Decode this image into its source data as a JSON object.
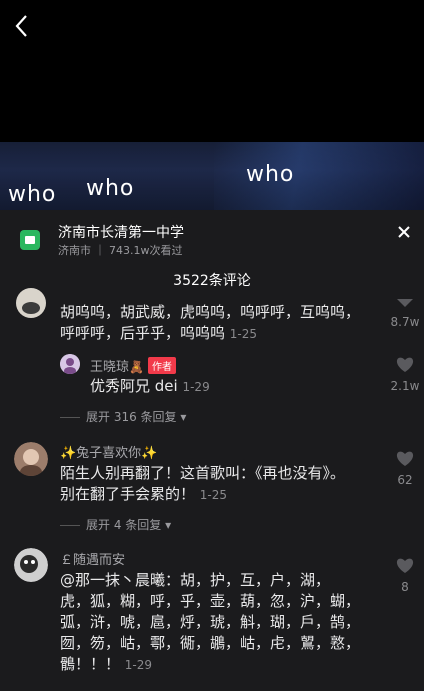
{
  "video": {
    "lyrics": [
      "who",
      "who",
      "who"
    ]
  },
  "location": {
    "title": "济南市长清第一中学",
    "subtitle": "济南市 ｜ 743.1w次看过"
  },
  "comments_header": {
    "count_label": "3522条评论"
  },
  "comments": [
    {
      "text_lines": [
        "胡呜呜，胡武威，虎呜呜，呜呼呼，互呜呜，",
        "呼呼呼，后乎乎，呜呜呜"
      ],
      "time": "1-25",
      "likes": "8.7w",
      "reply": {
        "author": "王晓琼",
        "author_badge": "作者",
        "text": "优秀阿兄 dei",
        "time": "1-29",
        "likes": "2.1w"
      },
      "expand_label": "展开 316 条回复"
    },
    {
      "author": "✨兔子喜欢你✨",
      "text_lines": [
        "陌生人别再翻了！这首歌叫：《再也没有》。",
        "别在翻了手会累的！"
      ],
      "time": "1-25",
      "likes": "62",
      "expand_label": "展开 4 条回复"
    },
    {
      "author": "￡随遇而安",
      "text_lines": [
        "@那一抹丶晨曦：胡，护，互，户，湖，",
        "虎，狐，糊，呼，乎，壶，葫，忽，沪，蝴，",
        "弧，浒，唬，扈，烀，琥，斛，瑚，戶，鹄，",
        "囫，笏，岵，鄠，衚，鶘，岵，虍，鶦，憝，",
        "鶻！！！"
      ],
      "time": "1-29",
      "likes": "8"
    }
  ],
  "colors": {
    "panel_bg": "#1b1b1d",
    "author_badge": "#f23a4a",
    "location_icon": "#29b75e"
  },
  "icons": [
    "back-arrow-icon",
    "location-icon",
    "close-icon",
    "heart-icon"
  ]
}
